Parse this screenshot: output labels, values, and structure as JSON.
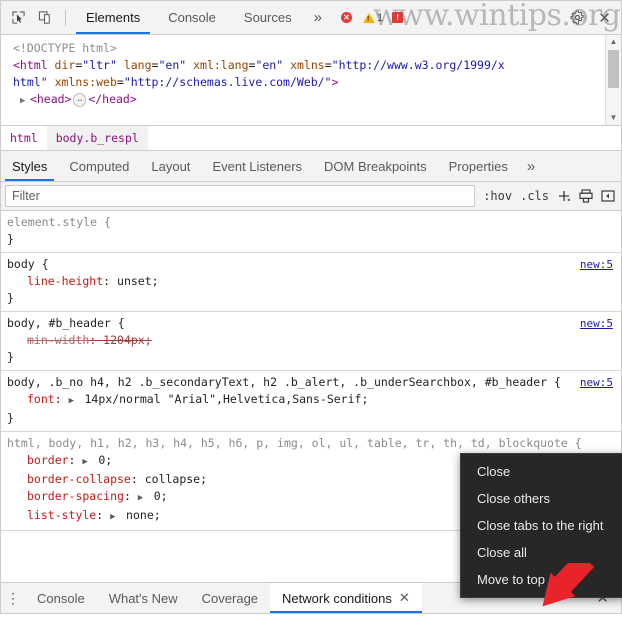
{
  "toolbar": {
    "inspect_icon": "inspect-element-icon",
    "device_icon": "device-toolbar-icon",
    "tabs": [
      {
        "label": "Elements",
        "selected": true
      },
      {
        "label": "Console",
        "selected": false
      },
      {
        "label": "Sources",
        "selected": false
      }
    ],
    "overflow_label": "»",
    "errors": {
      "count": "",
      "color": "#e53935",
      "glyph": "✕"
    },
    "warnings": {
      "count": "1",
      "color": "#f5b400",
      "glyph": "!"
    },
    "issues": {
      "count": "",
      "color": "#e53935",
      "glyph": "!"
    },
    "settings_icon": "gear-icon",
    "close_icon": "close-icon",
    "close_glyph": "✕"
  },
  "watermark": {
    "text": "www.wintips.org"
  },
  "dom": {
    "doctype": "<!DOCTYPE html>",
    "line2_open": "<html ",
    "line2_attrs": [
      {
        "name": "dir",
        "value": "\"ltr\""
      },
      {
        "name": "lang",
        "value": "\"en\""
      },
      {
        "name": "xml:lang",
        "value": "\"en\""
      },
      {
        "name": "xmlns",
        "value": "\"http://www.w3.org/1999/x"
      }
    ],
    "line3_cont": "html\"",
    "line3_attr_name": "xmlns:web",
    "line3_attr_value": "\"http://schemas.live.com/Web/\"",
    "line3_close": ">",
    "head_twisty": "▶",
    "head_open": "<head>",
    "head_ellipsis": "…",
    "head_close": "</head>",
    "scroll_up": "▲",
    "scroll_down": "▼"
  },
  "breadcrumb": {
    "items": [
      {
        "label": "html",
        "selected": false
      },
      {
        "label": "body.b_respl",
        "selected": true
      }
    ]
  },
  "sidebar_tabs": {
    "tabs": [
      {
        "label": "Styles",
        "selected": true
      },
      {
        "label": "Computed",
        "selected": false
      },
      {
        "label": "Layout",
        "selected": false
      },
      {
        "label": "Event Listeners",
        "selected": false
      },
      {
        "label": "DOM Breakpoints",
        "selected": false
      },
      {
        "label": "Properties",
        "selected": false
      }
    ],
    "overflow_label": "»"
  },
  "filter_bar": {
    "placeholder": "Filter",
    "value": "",
    "hov_label": ":hov",
    "cls_label": ".cls",
    "new_rule_label": "+",
    "print_icon": "print-media-icon",
    "sidebar_toggle_icon": "toggle-sidebar-icon"
  },
  "styles": {
    "rules": [
      {
        "selector": "element.style",
        "source": "",
        "declarations": []
      },
      {
        "selector": "body",
        "source": "new:5",
        "declarations": [
          {
            "prop": "line-height",
            "value": "unset",
            "disabled": false,
            "expandable": false
          }
        ]
      },
      {
        "selector": "body, #b_header",
        "source": "new:5",
        "declarations": [
          {
            "prop": "min-width",
            "value": "1204px",
            "disabled": true,
            "expandable": false
          }
        ]
      },
      {
        "selector": "body, .b_no h4, h2 .b_secondaryText, h2 .b_alert, .b_underSearchbox, #b_header",
        "source": "new:5",
        "declarations": [
          {
            "prop": "font",
            "value": "14px/normal \"Arial\",Helvetica,Sans-Serif",
            "disabled": false,
            "expandable": true
          }
        ]
      },
      {
        "selector": "html, body, h1, h2, h3, h4, h5, h6, p, img, ol, ul, table, tr, th, td, blockquote",
        "match_token": "body",
        "source": "",
        "declarations": [
          {
            "prop": "border",
            "value": "0",
            "disabled": false,
            "expandable": true
          },
          {
            "prop": "border-collapse",
            "value": "collapse",
            "disabled": false,
            "expandable": false
          },
          {
            "prop": "border-spacing",
            "value": "0",
            "disabled": false,
            "expandable": true
          },
          {
            "prop": "list-style",
            "value": "none",
            "disabled": false,
            "expandable": true
          }
        ]
      }
    ]
  },
  "context_menu": {
    "items": [
      {
        "label": "Close"
      },
      {
        "label": "Close others"
      },
      {
        "label": "Close tabs to the right"
      },
      {
        "label": "Close all"
      },
      {
        "label": "Move to top"
      }
    ]
  },
  "drawer": {
    "menu_icon": "more-options-icon",
    "menu_glyph": "⋮",
    "tabs": [
      {
        "label": "Console",
        "selected": false,
        "closable": false
      },
      {
        "label": "What's New",
        "selected": false,
        "closable": false
      },
      {
        "label": "Coverage",
        "selected": false,
        "closable": false
      },
      {
        "label": "Network conditions",
        "selected": true,
        "closable": true
      }
    ],
    "tab_close_glyph": "✕",
    "close_glyph": "✕"
  }
}
